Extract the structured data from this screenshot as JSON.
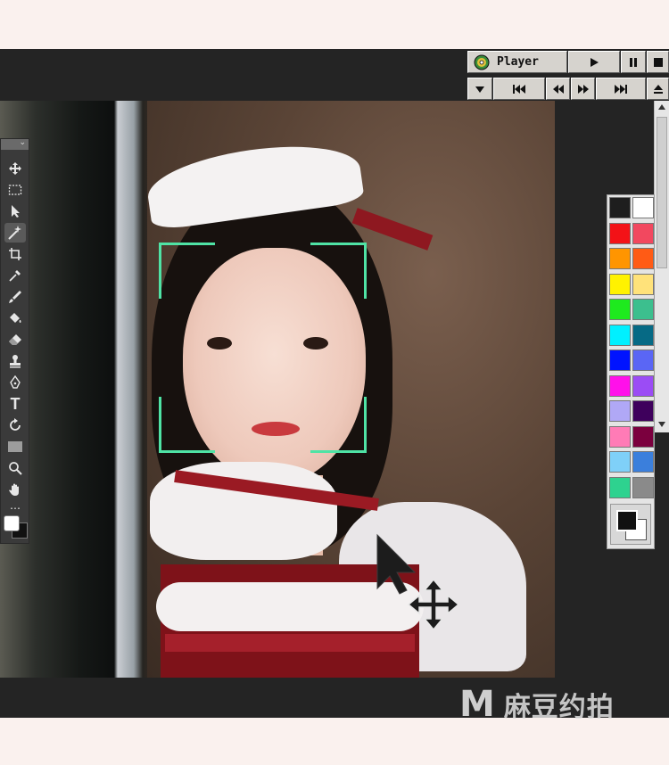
{
  "player": {
    "title": "Player",
    "icon": "cd-disc-icon",
    "buttons": [
      "play",
      "pause",
      "stop",
      "menu-down",
      "previous-track",
      "rewind",
      "fast-forward",
      "next-track",
      "eject"
    ]
  },
  "toolbar": {
    "tools": [
      "move-tool-icon",
      "marquee-tool-icon",
      "selection-arrow-icon",
      "magic-wand-icon",
      "crop-tool-icon",
      "eyedropper-icon",
      "brush-tool-icon",
      "paint-bucket-icon",
      "eraser-icon",
      "stamp-tool-icon",
      "pen-tool-icon",
      "text-tool-icon",
      "rotate-tool-icon",
      "rectangle-tool-icon",
      "zoom-tool-icon",
      "hand-tool-icon"
    ],
    "active_tool": "magic-wand-icon",
    "text_tool_glyph": "T",
    "more_glyph": "…"
  },
  "palette": {
    "colors": [
      "#1e1e1e",
      "#ffffff",
      "#f31217",
      "#f2485f",
      "#ff9500",
      "#ff5b15",
      "#fff200",
      "#ffe27a",
      "#1eea1e",
      "#3cbf8e",
      "#00f0ff",
      "#066a85",
      "#0013ff",
      "#5a66f5",
      "#ff10ea",
      "#9b4cf5",
      "#b0a8f6",
      "#3e005c",
      "#ff7bb6",
      "#7b003e",
      "#7fd0f8",
      "#3b7fdc",
      "#2ed28f",
      "#8a8a8a"
    ],
    "foreground": "#111111",
    "background": "#ffffff"
  },
  "overlay": {
    "face_frame_color": "#4fe3a5",
    "cursor": "arrow-cursor-icon",
    "move_cursor": "move-arrows-icon"
  },
  "watermark": {
    "logo": "M",
    "text": "麻豆约拍"
  }
}
